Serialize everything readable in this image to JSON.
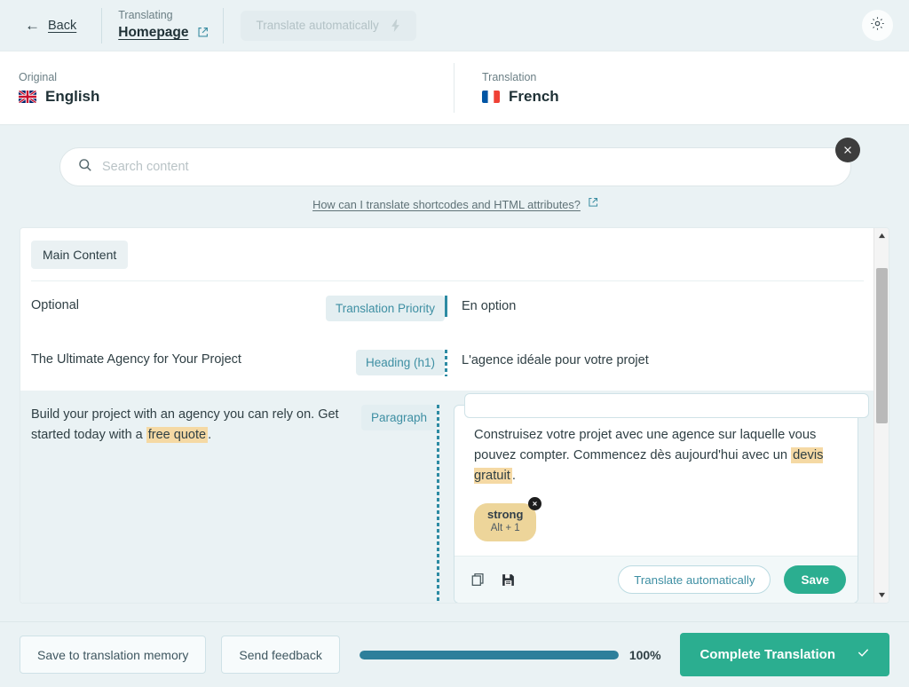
{
  "topbar": {
    "back_label": "Back",
    "translating_kicker": "Translating",
    "page_name": "Homepage",
    "external_link_icon": "external-link-icon",
    "translate_auto_label": "Translate automatically",
    "bolt_icon": "lightning-bolt-icon",
    "gear_icon": "gear-icon"
  },
  "languages": {
    "original_kicker": "Original",
    "original_language": "English",
    "original_flag": "flag-uk",
    "translation_kicker": "Translation",
    "translation_language": "French",
    "translation_flag": "flag-fr"
  },
  "search": {
    "placeholder": "Search content",
    "value": "",
    "icon": "search-icon",
    "close_icon": "close-icon",
    "help_link": "How can I translate shortcodes and HTML attributes?",
    "help_external_icon": "external-link-icon"
  },
  "content": {
    "tab_label": "Main Content",
    "rows": [
      {
        "source": "Optional",
        "badge": "Translation Priority",
        "target": "En option",
        "marker": "solid"
      },
      {
        "source": "The Ultimate Agency for Your Project",
        "badge": "Heading (h1)",
        "target": "L'agence idéale pour votre projet",
        "marker": "dotted"
      }
    ],
    "active_row": {
      "source_part1": "Build your project with an agency you can rely on. Get started today with a ",
      "source_highlight": "free quote",
      "source_part2": ".",
      "badge": "Paragraph",
      "editor": {
        "text_part1": "Construisez votre projet avec une agence sur laquelle vous pouvez compter. Commencez dès aujourd'hui avec un ",
        "text_highlight": "devis gratuit",
        "text_part2": ".",
        "tag_name": "strong",
        "tag_shortcut": "Alt + 1",
        "tag_remove_icon": "close-icon",
        "copy_icon": "copy-icon",
        "save_icon": "floppy-disk-icon",
        "translate_auto_label": "Translate automatically",
        "save_label": "Save",
        "close_icon": "close-icon"
      }
    }
  },
  "scrollbar": {
    "up_icon": "chevron-up-icon",
    "down_icon": "chevron-down-icon"
  },
  "bottombar": {
    "save_memory_label": "Save to translation memory",
    "send_feedback_label": "Send feedback",
    "progress_percent": "100%",
    "progress_value": 100,
    "complete_label": "Complete Translation",
    "complete_icon": "check-icon"
  },
  "colors": {
    "accent_teal": "#2d8ba3",
    "accent_green": "#2bae90",
    "highlight_amber": "#f5d9a4",
    "page_bg": "#eaf2f4"
  }
}
